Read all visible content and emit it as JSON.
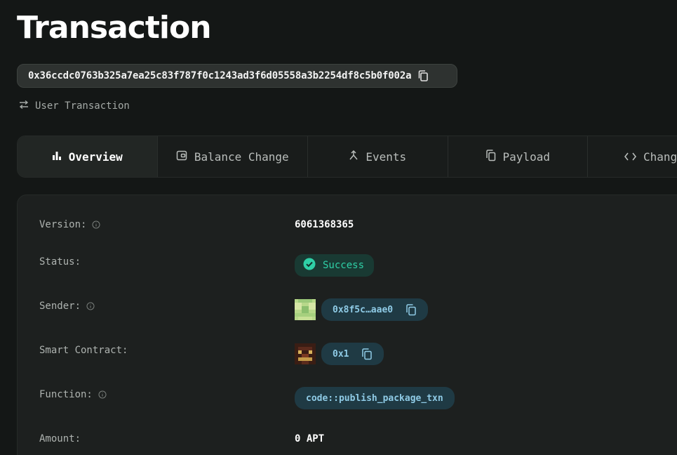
{
  "page": {
    "title": "Transaction"
  },
  "transaction": {
    "hash": "0x36ccdc0763b325a7ea25c83f787f0c1243ad3f6d05558a3b2254df8c5b0f002a",
    "type_label": "User Transaction"
  },
  "tabs": [
    {
      "label": "Overview",
      "icon": "bar-chart-icon",
      "active": true
    },
    {
      "label": "Balance Change",
      "icon": "wallet-icon"
    },
    {
      "label": "Events",
      "icon": "events-icon"
    },
    {
      "label": "Payload",
      "icon": "copy-doc-icon"
    },
    {
      "label": "Changes",
      "icon": "code-icon"
    }
  ],
  "details": {
    "version": {
      "label": "Version:",
      "value": "6061368365"
    },
    "status": {
      "label": "Status:",
      "value": "Success"
    },
    "sender": {
      "label": "Sender:",
      "value": "0x8f5c…aae0"
    },
    "smart_contract": {
      "label": "Smart Contract:",
      "value": "0x1"
    },
    "function": {
      "label": "Function:",
      "value": "code::publish_package_txn"
    },
    "amount": {
      "label": "Amount:",
      "value": "0 APT"
    }
  },
  "colors": {
    "background": "#141716",
    "panel": "#1d201f",
    "success_text": "#2fd0a7",
    "success_bg": "#193a33",
    "address_text": "#8fcbe6",
    "address_bg": "#1f3a44"
  }
}
